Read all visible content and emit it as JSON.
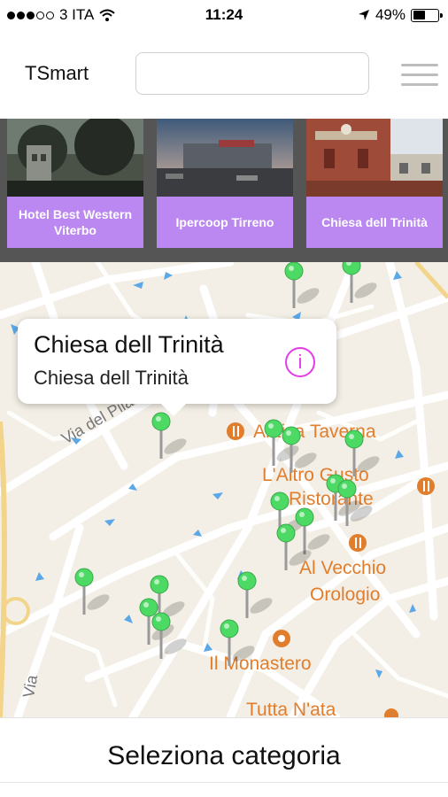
{
  "status_bar": {
    "carrier": "3 ITA",
    "time": "11:24",
    "battery": "49%",
    "battery_level": 0.49,
    "icons": [
      "signal-dots-icon",
      "wifi-icon",
      "location-arrow-icon",
      "battery-icon"
    ]
  },
  "header": {
    "title": "TSmart",
    "search_value": "",
    "search_placeholder": "",
    "menu_icon": "hamburger-menu-icon"
  },
  "carousel": {
    "items": [
      {
        "label": "Hotel Best Western Viterbo"
      },
      {
        "label": "Ipercoop Tirreno"
      },
      {
        "label": "Chiesa dell Trinità"
      }
    ]
  },
  "map": {
    "callout": {
      "title": "Chiesa dell Trinità",
      "subtitle": "Chiesa dell Trinità",
      "info_icon": "info-icon"
    },
    "poi_labels": {
      "antica_taverna": "Antica Taverna",
      "laltro_gusto_1": "L'Altro Gusto",
      "laltro_gusto_2": "Ristorante",
      "vecchio_orologio_1": "Al Vecchio",
      "vecchio_orologio_2": "Orologio",
      "monastero": "Il Monastero",
      "tutta_nata": "Tutta N'ata"
    },
    "street_labels": {
      "via_pilastro": "Via del Pila",
      "via_side": "Via"
    },
    "pin_color": "#4cd964",
    "poi_color": "#e07e2e"
  },
  "footer": {
    "category_button": "Seleziona categoria"
  },
  "colors": {
    "card_label_bg": "#ba88f0",
    "carousel_bg": "#555555",
    "info_accent": "#e63be6",
    "map_bg": "#f3efe6"
  }
}
